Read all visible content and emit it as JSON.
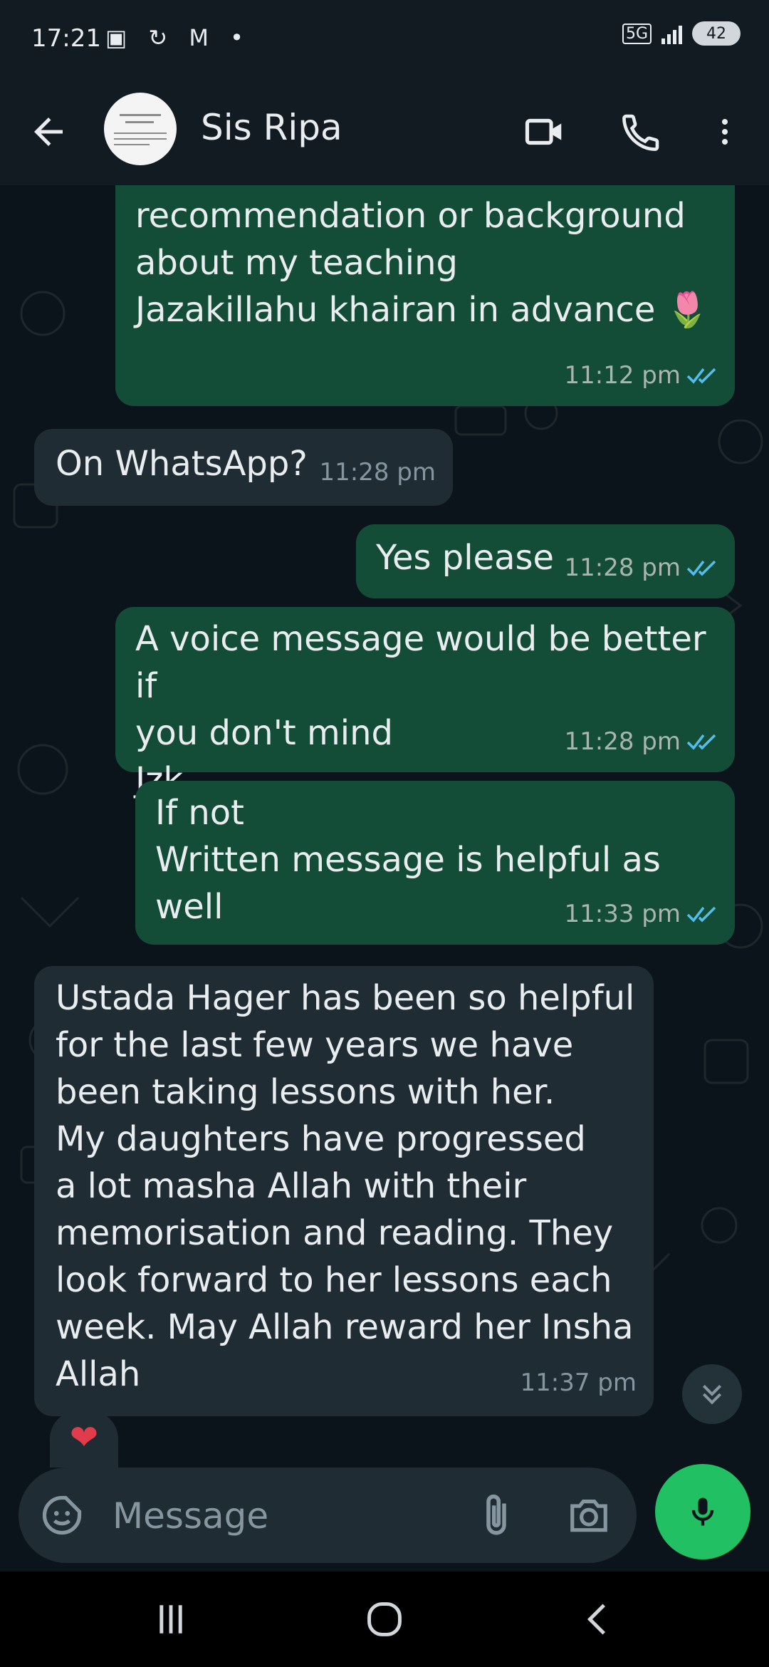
{
  "status_bar": {
    "time": "17:21",
    "notification_icons": "▣ ↻ M •",
    "network": "5G",
    "battery": "42"
  },
  "header": {
    "contact_name": "Sis Ripa",
    "icons": [
      "back-arrow-icon",
      "video-call-icon",
      "phone-icon",
      "more-options-icon"
    ]
  },
  "messages": [
    {
      "direction": "out",
      "text": "recommendation or  background\nabout my teaching\nJazakillahu khairan in advance 🌷",
      "time": "11:12 pm",
      "status": "read"
    },
    {
      "direction": "in",
      "text": "On WhatsApp?",
      "time": "11:28 pm"
    },
    {
      "direction": "out",
      "text": "Yes please",
      "time": "11:28 pm",
      "status": "read"
    },
    {
      "direction": "out",
      "text": "A voice message would be better if\nyou don't mind\nJzk",
      "time": "11:28 pm",
      "status": "read"
    },
    {
      "direction": "out",
      "text": "If not\nWritten message is helpful as well",
      "time": "11:33 pm",
      "status": "read"
    },
    {
      "direction": "in",
      "text": "Ustada Hager has been so helpful\nfor the last few years we have\nbeen taking lessons with her.\nMy daughters have progressed\na lot masha Allah with their\nmemorisation and reading. They\nlook forward to her lessons each\nweek. May Allah reward her Insha\nAllah",
      "time": "11:37 pm",
      "reaction": "❤"
    }
  ],
  "composer": {
    "placeholder": "Message"
  },
  "colors": {
    "background": "#0b141a",
    "outgoing_bubble": "#144d37",
    "incoming_bubble": "#202c33",
    "read_ticks": "#53bdeb",
    "mic_button": "#21c063"
  }
}
